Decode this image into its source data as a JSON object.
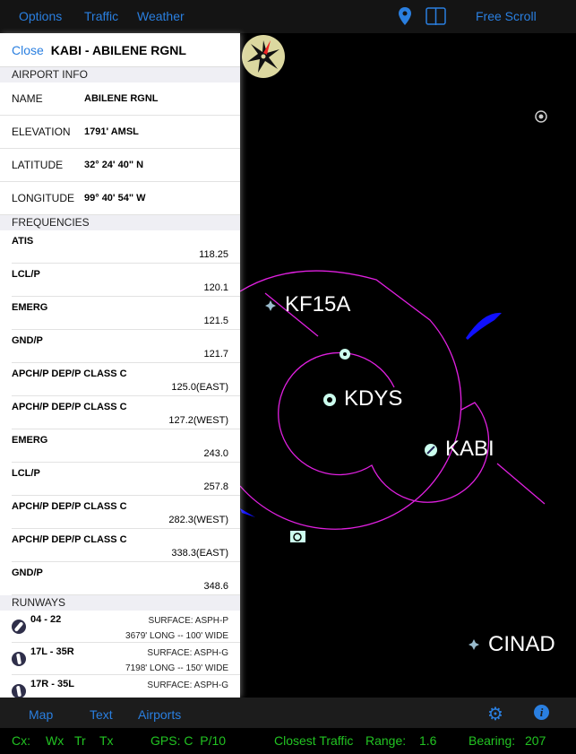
{
  "topbar": {
    "options": "Options",
    "traffic": "Traffic",
    "weather": "Weather",
    "free_scroll": "Free Scroll"
  },
  "panel": {
    "close": "Close",
    "title": "KABI - ABILENE RGNL",
    "airport_info_header": "AIRPORT INFO",
    "info": [
      {
        "label": "NAME",
        "value": "ABILENE RGNL"
      },
      {
        "label": "ELEVATION",
        "value": "1791' AMSL"
      },
      {
        "label": "LATITUDE",
        "value": "32° 24' 40\" N"
      },
      {
        "label": "LONGITUDE",
        "value": "99° 40' 54\" W"
      }
    ],
    "frequencies_header": "FREQUENCIES",
    "frequencies": [
      {
        "name": "ATIS",
        "freq": "118.25"
      },
      {
        "name": "LCL/P",
        "freq": "120.1"
      },
      {
        "name": "EMERG",
        "freq": "121.5"
      },
      {
        "name": "GND/P",
        "freq": "121.7"
      },
      {
        "name": "APCH/P DEP/P CLASS C",
        "freq": "125.0(EAST)"
      },
      {
        "name": "APCH/P DEP/P CLASS C",
        "freq": "127.2(WEST)"
      },
      {
        "name": "EMERG",
        "freq": "243.0"
      },
      {
        "name": "LCL/P",
        "freq": "257.8"
      },
      {
        "name": "APCH/P DEP/P CLASS C",
        "freq": "282.3(WEST)"
      },
      {
        "name": "APCH/P DEP/P CLASS C",
        "freq": "338.3(EAST)"
      },
      {
        "name": "GND/P",
        "freq": "348.6"
      }
    ],
    "runways_header": "RUNWAYS",
    "runways": [
      {
        "id": "04 - 22",
        "surface": "SURFACE: ASPH-P",
        "dims": "3679' LONG -- 100' WIDE",
        "heading": 40
      },
      {
        "id": "17L - 35R",
        "surface": "SURFACE: ASPH-G",
        "dims": "7198' LONG -- 150' WIDE",
        "heading": 170
      },
      {
        "id": "17R - 35L",
        "surface": "SURFACE: ASPH-G",
        "dims": "",
        "heading": 170
      }
    ]
  },
  "map": {
    "labels": {
      "kf15a": "KF15A",
      "kdys": "KDYS",
      "kabi": "KABI",
      "cinad": "CINAD"
    },
    "airspace_color": "#e020e0",
    "water_color": "#1010ff"
  },
  "bottombar": {
    "map": "Map",
    "text": "Text",
    "airports": "Airports"
  },
  "status": {
    "cx": "Cx:",
    "wx": "Wx",
    "tr": "Tr",
    "tx": "Tx",
    "gps": "GPS: C  P/10",
    "closest": "Closest Traffic",
    "range_label": "Range:",
    "range": "1.6",
    "bearing_label": "Bearing:",
    "bearing": "207"
  }
}
